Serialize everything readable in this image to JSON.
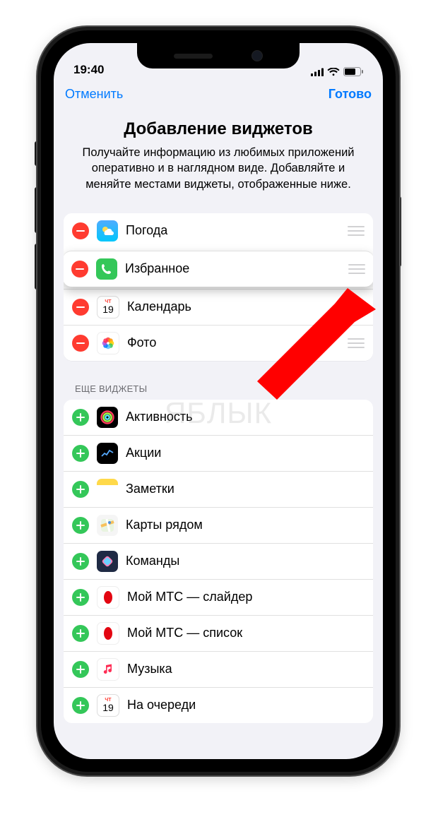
{
  "status": {
    "time": "19:40"
  },
  "nav": {
    "cancel": "Отменить",
    "done": "Готово"
  },
  "header": {
    "title": "Добавление виджетов",
    "subtitle": "Получайте информацию из любимых приложений оперативно и в наглядном виде. Добавляйте и меняйте местами виджеты, отображенные ниже."
  },
  "active": [
    {
      "label": "Погода",
      "icon": "weather"
    },
    {
      "label": "Избранное",
      "icon": "phone"
    },
    {
      "label": "Календарь",
      "icon": "calendar",
      "badge": "19"
    },
    {
      "label": "Фото",
      "icon": "photos"
    }
  ],
  "more_header": "ЕЩЕ ВИДЖЕТЫ",
  "more": [
    {
      "label": "Активность",
      "icon": "activity"
    },
    {
      "label": "Акции",
      "icon": "stocks"
    },
    {
      "label": "Заметки",
      "icon": "notes"
    },
    {
      "label": "Карты рядом",
      "icon": "maps"
    },
    {
      "label": "Команды",
      "icon": "shortcuts"
    },
    {
      "label": "Мой МТС — слайдер",
      "icon": "mts"
    },
    {
      "label": "Мой МТС — список",
      "icon": "mts"
    },
    {
      "label": "Музыка",
      "icon": "music"
    },
    {
      "label": "На очереди",
      "icon": "calendar",
      "badge": "19"
    }
  ],
  "watermark": "ЯБЛЫК"
}
